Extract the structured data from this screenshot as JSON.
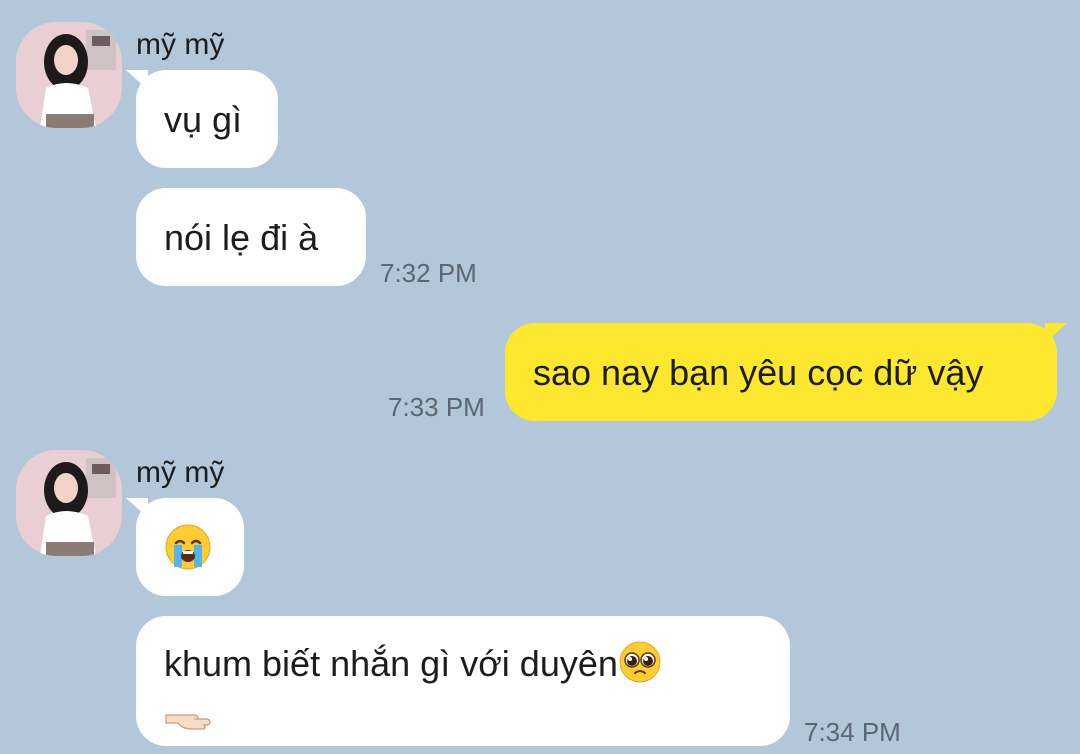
{
  "contact": {
    "name": "mỹ mỹ"
  },
  "messages": [
    {
      "sender": "mỹ mỹ",
      "direction": "incoming",
      "text": "vụ gì"
    },
    {
      "sender": "mỹ mỹ",
      "direction": "incoming",
      "text": "nói lẹ đi à",
      "time": "7:32 PM"
    },
    {
      "sender": "me",
      "direction": "outgoing",
      "text": "sao nay bạn yêu cọc dữ vậy",
      "time": "7:33 PM"
    },
    {
      "sender": "mỹ mỹ",
      "direction": "incoming",
      "emoji": "loudly-crying-face-icon"
    },
    {
      "sender": "mỹ mỹ",
      "direction": "incoming",
      "text": "khum biết nhắn gì với duyên",
      "emoji": [
        "pleading-face-icon",
        "pointing-hand-icon"
      ],
      "time": "7:34 PM"
    }
  ],
  "colors": {
    "background": "#b2c7da",
    "incoming_bubble": "#ffffff",
    "outgoing_bubble": "#fee82f",
    "timestamp": "#5c6673"
  }
}
